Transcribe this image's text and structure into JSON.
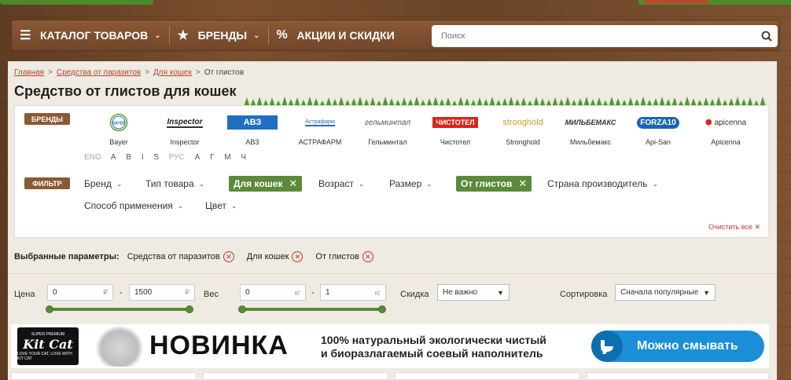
{
  "nav": {
    "catalog_label": "КАТАЛОГ ТОВАРОВ",
    "brands_label": "БРЕНДЫ",
    "sales_label": "АКЦИИ И СКИДКИ",
    "search_placeholder": "Поиск"
  },
  "breadcrumb": {
    "items": [
      "Главная",
      "Средства от паразитов",
      "Для кошек"
    ],
    "current": "От глистов",
    "separator": ">"
  },
  "page_title": "Средство от глистов для кошек",
  "brands": {
    "tag": "БРЕНДЫ",
    "items": [
      {
        "name": "Bayer",
        "logo": "BAYER"
      },
      {
        "name": "Inspector",
        "logo": "Inspector"
      },
      {
        "name": "АВЗ",
        "logo": "АВЗ"
      },
      {
        "name": "АСТРАФАРМ",
        "logo": "Астрафарм"
      },
      {
        "name": "Гельминтал",
        "logo": "гельминтал"
      },
      {
        "name": "Чистотел",
        "logo": "ЧИСТОТЕЛ"
      },
      {
        "name": "Stronghold",
        "logo": "stronghold"
      },
      {
        "name": "Мильбемакс",
        "logo": "МИЛЬБЕМАКС"
      },
      {
        "name": "Api-San",
        "logo": "FORZA10"
      },
      {
        "name": "Apicenna",
        "logo": "apicenna"
      }
    ],
    "alphabet": {
      "eng_label": "ENG",
      "eng": [
        "A",
        "B",
        "I",
        "S"
      ],
      "rus_label": "РУС",
      "rus": [
        "А",
        "Г",
        "М",
        "Ч"
      ]
    }
  },
  "filter": {
    "tag": "ФИЛЬТР",
    "items": [
      "Бренд",
      "Тип товара",
      "Возраст",
      "Размер",
      "Страна производитель",
      "Способ применения",
      "Цвет"
    ],
    "active": [
      "Для кошек",
      "От глистов"
    ],
    "clear_all": "Очистить все"
  },
  "selected": {
    "label": "Выбранные параметры:",
    "chips": [
      "Средства от паразитов",
      "Для кошек",
      "От глистов"
    ]
  },
  "params": {
    "price_label": "Цена",
    "price_from": "0",
    "price_to": "1500",
    "price_unit": "₽",
    "weight_label": "Вес",
    "weight_from": "0",
    "weight_to": "1",
    "weight_unit": "кг",
    "discount_label": "Скидка",
    "discount_value": "Не важно",
    "sort_label": "Сортировка",
    "sort_value": "Сначала популярные"
  },
  "banner": {
    "kitcat_brand": "Kit Cat",
    "kitcat_top": "SUPER PREMIUM",
    "kitcat_bottom": "LOVE YOUR CAT, LOVE WITH KIT CAT",
    "headline": "НОВИНКА",
    "slogan_line1": "100% натуральный экологически чистый",
    "slogan_line2": "и биоразлагаемый соевый наполнитель",
    "button": "Можно смывать"
  },
  "colors": {
    "accent_green": "#5b8a3a",
    "brown": "#8b5a33",
    "link_red": "#b5452b",
    "banner_blue": "#1a8fd8"
  }
}
